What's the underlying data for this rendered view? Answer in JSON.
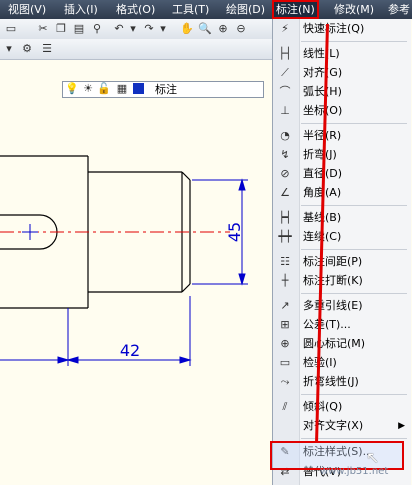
{
  "menubar": {
    "items": [
      {
        "label": "视图(V)"
      },
      {
        "label": "插入(I)"
      },
      {
        "label": "格式(O)"
      },
      {
        "label": "工具(T)"
      },
      {
        "label": "绘图(D)"
      },
      {
        "label": "标注(N)"
      },
      {
        "label": "修改(M)"
      },
      {
        "label": "参考"
      }
    ],
    "active_index": 5
  },
  "toolbar": {
    "layer_name": "标注"
  },
  "drawing": {
    "dim_vertical": "45",
    "dim_horizontal": "42"
  },
  "dimension_menu": {
    "items": [
      {
        "label": "快速标注(Q)",
        "icon": "quick-dimension-icon"
      },
      {
        "label": "线性(L)",
        "icon": "linear-icon"
      },
      {
        "label": "对齐(G)",
        "icon": "aligned-icon"
      },
      {
        "label": "弧长(H)",
        "icon": "arc-length-icon"
      },
      {
        "label": "坐标(O)",
        "icon": "ordinate-icon"
      },
      {
        "label": "半径(R)",
        "icon": "radius-icon"
      },
      {
        "label": "折弯(J)",
        "icon": "jogged-icon"
      },
      {
        "label": "直径(D)",
        "icon": "diameter-icon"
      },
      {
        "label": "角度(A)",
        "icon": "angular-icon"
      },
      {
        "label": "基线(B)",
        "icon": "baseline-icon"
      },
      {
        "label": "连续(C)",
        "icon": "continue-icon"
      },
      {
        "label": "标注间距(P)",
        "icon": "dim-space-icon"
      },
      {
        "label": "标注打断(K)",
        "icon": "dim-break-icon"
      },
      {
        "label": "多重引线(E)",
        "icon": "multileader-icon"
      },
      {
        "label": "公差(T)...",
        "icon": "tolerance-icon"
      },
      {
        "label": "圆心标记(M)",
        "icon": "center-mark-icon"
      },
      {
        "label": "检验(I)",
        "icon": "inspection-icon"
      },
      {
        "label": "折弯线性(J)",
        "icon": "jogged-linear-icon"
      },
      {
        "label": "倾斜(Q)",
        "icon": "oblique-icon"
      },
      {
        "label": "对齐文字(X)",
        "icon": ""
      },
      {
        "label": "标注样式(S)...",
        "icon": "dim-style-icon"
      },
      {
        "label": "替代(V)",
        "icon": "override-icon"
      }
    ]
  },
  "watermark": "www.jb51.net",
  "colors": {
    "highlight": "#e00000",
    "canvas": "#fffdf0",
    "dimension": "#0000cc",
    "centerline": "#e00000"
  }
}
